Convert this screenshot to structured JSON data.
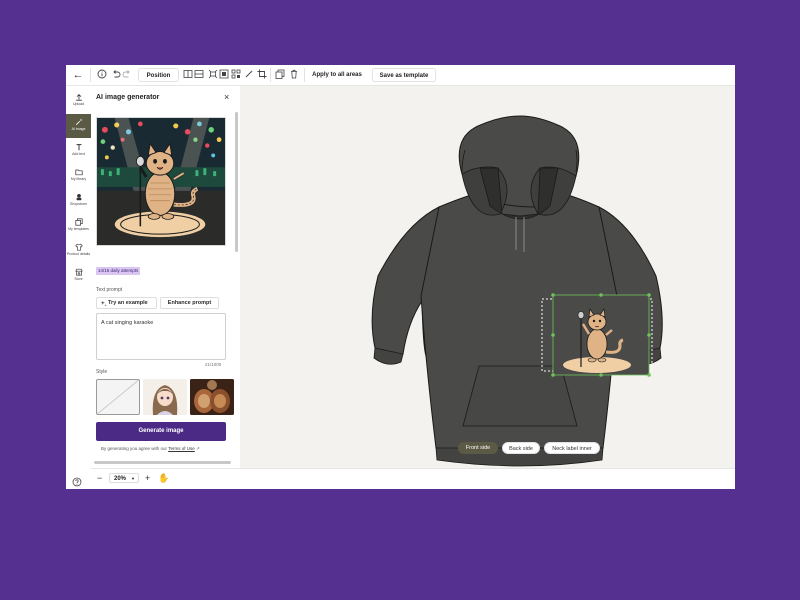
{
  "toolbar": {
    "position_label": "Position",
    "apply_label": "Apply to all areas",
    "save_template_label": "Save as template"
  },
  "sidebar": {
    "items": [
      {
        "label": "Upload",
        "icon": "upload-icon"
      },
      {
        "label": "AI image",
        "icon": "ai-image-icon"
      },
      {
        "label": "Add text",
        "icon": "text-icon"
      },
      {
        "label": "My library",
        "icon": "folder-icon"
      },
      {
        "label": "Shopstorm",
        "icon": "shopstorm-icon"
      },
      {
        "label": "My templates",
        "icon": "templates-icon"
      },
      {
        "label": "Product details",
        "icon": "product-details-icon"
      },
      {
        "label": "Store",
        "icon": "store-icon"
      }
    ],
    "active": "AI image"
  },
  "panel": {
    "title": "AI image generator",
    "attempts_badge": "14/15 daily attempts",
    "text_prompt_label": "Text prompt",
    "try_example_label": "Try an example",
    "enhance_label": "Enhance prompt",
    "prompt_value": "A cat singing karaoke",
    "char_counter": "21/1000",
    "style_label": "Style",
    "generate_label": "Generate image",
    "terms_prefix": "By generating you agree with our",
    "terms_link": "Terms of Use"
  },
  "zoom": {
    "value": "20%"
  },
  "canvas": {
    "product": "hoodie",
    "product_color": "#4a4a48",
    "side_tabs": [
      {
        "label": "Front side",
        "active": true
      },
      {
        "label": "Back side",
        "active": false
      },
      {
        "label": "Neck label inner",
        "active": false
      }
    ]
  },
  "colors": {
    "background": "#553091",
    "primary_button": "#4b2a85",
    "active_tab": "#5b5a45",
    "badge_bg": "#d9c6f2",
    "selection": "#6dc25a"
  }
}
